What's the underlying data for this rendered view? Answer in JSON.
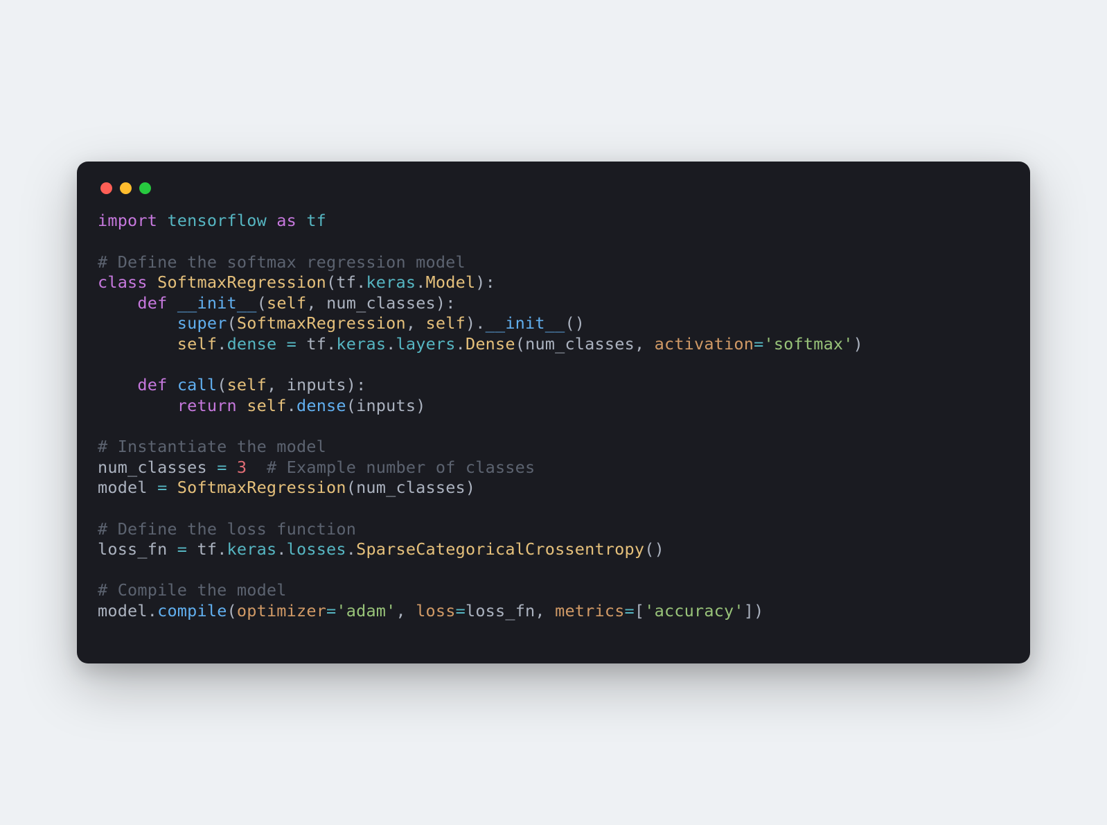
{
  "window": {
    "controls": [
      "close",
      "minimize",
      "zoom"
    ]
  },
  "colors": {
    "background_page": "#eef1f4",
    "background_window": "#1a1b21",
    "text_default": "#abb2bf",
    "keyword": "#c678dd",
    "module": "#56b6c2",
    "class_name": "#e5c07b",
    "function": "#61afef",
    "self": "#e5c07b",
    "operator": "#56b6c2",
    "number": "#e06c75",
    "string": "#98c379",
    "comment": "#5c6370",
    "kwarg": "#d19a66",
    "variable": "#e06c75",
    "dot_red": "#ff5f56",
    "dot_yellow": "#ffbd2e",
    "dot_green": "#27c93f"
  },
  "code": {
    "language": "python",
    "lines": [
      [
        {
          "t": "import ",
          "c": "kw"
        },
        {
          "t": "tensorflow",
          "c": "mod"
        },
        {
          "t": " as ",
          "c": "kw"
        },
        {
          "t": "tf",
          "c": "mod"
        }
      ],
      [],
      [
        {
          "t": "# Define the softmax regression model",
          "c": "comment"
        }
      ],
      [
        {
          "t": "class ",
          "c": "kw"
        },
        {
          "t": "SoftmaxRegression",
          "c": "class"
        },
        {
          "t": "(",
          "c": "punc"
        },
        {
          "t": "tf",
          "c": "ident"
        },
        {
          "t": ".",
          "c": "punc"
        },
        {
          "t": "keras",
          "c": "attr"
        },
        {
          "t": ".",
          "c": "punc"
        },
        {
          "t": "Model",
          "c": "class"
        },
        {
          "t": "):",
          "c": "punc"
        }
      ],
      [
        {
          "t": "    ",
          "c": "punc"
        },
        {
          "t": "def ",
          "c": "kw"
        },
        {
          "t": "__init__",
          "c": "func"
        },
        {
          "t": "(",
          "c": "punc"
        },
        {
          "t": "self",
          "c": "self"
        },
        {
          "t": ", ",
          "c": "punc"
        },
        {
          "t": "num_classes",
          "c": "param"
        },
        {
          "t": "):",
          "c": "punc"
        }
      ],
      [
        {
          "t": "        ",
          "c": "punc"
        },
        {
          "t": "super",
          "c": "func"
        },
        {
          "t": "(",
          "c": "punc"
        },
        {
          "t": "SoftmaxRegression",
          "c": "class"
        },
        {
          "t": ", ",
          "c": "punc"
        },
        {
          "t": "self",
          "c": "self"
        },
        {
          "t": ").",
          "c": "punc"
        },
        {
          "t": "__init__",
          "c": "func"
        },
        {
          "t": "()",
          "c": "punc"
        }
      ],
      [
        {
          "t": "        ",
          "c": "punc"
        },
        {
          "t": "self",
          "c": "self"
        },
        {
          "t": ".",
          "c": "punc"
        },
        {
          "t": "dense",
          "c": "attr"
        },
        {
          "t": " = ",
          "c": "op"
        },
        {
          "t": "tf",
          "c": "ident"
        },
        {
          "t": ".",
          "c": "punc"
        },
        {
          "t": "keras",
          "c": "attr"
        },
        {
          "t": ".",
          "c": "punc"
        },
        {
          "t": "layers",
          "c": "attr"
        },
        {
          "t": ".",
          "c": "punc"
        },
        {
          "t": "Dense",
          "c": "class"
        },
        {
          "t": "(",
          "c": "punc"
        },
        {
          "t": "num_classes",
          "c": "ident"
        },
        {
          "t": ", ",
          "c": "punc"
        },
        {
          "t": "activation",
          "c": "kwarg"
        },
        {
          "t": "=",
          "c": "op"
        },
        {
          "t": "'softmax'",
          "c": "str"
        },
        {
          "t": ")",
          "c": "punc"
        }
      ],
      [],
      [
        {
          "t": "    ",
          "c": "punc"
        },
        {
          "t": "def ",
          "c": "kw"
        },
        {
          "t": "call",
          "c": "func"
        },
        {
          "t": "(",
          "c": "punc"
        },
        {
          "t": "self",
          "c": "self"
        },
        {
          "t": ", ",
          "c": "punc"
        },
        {
          "t": "inputs",
          "c": "param"
        },
        {
          "t": "):",
          "c": "punc"
        }
      ],
      [
        {
          "t": "        ",
          "c": "punc"
        },
        {
          "t": "return ",
          "c": "kw"
        },
        {
          "t": "self",
          "c": "self"
        },
        {
          "t": ".",
          "c": "punc"
        },
        {
          "t": "dense",
          "c": "func"
        },
        {
          "t": "(",
          "c": "punc"
        },
        {
          "t": "inputs",
          "c": "ident"
        },
        {
          "t": ")",
          "c": "punc"
        }
      ],
      [],
      [
        {
          "t": "# Instantiate the model",
          "c": "comment"
        }
      ],
      [
        {
          "t": "num_classes",
          "c": "ident"
        },
        {
          "t": " = ",
          "c": "op"
        },
        {
          "t": "3",
          "c": "num"
        },
        {
          "t": "  ",
          "c": "punc"
        },
        {
          "t": "# Example number of classes",
          "c": "comment"
        }
      ],
      [
        {
          "t": "model",
          "c": "ident"
        },
        {
          "t": " = ",
          "c": "op"
        },
        {
          "t": "SoftmaxRegression",
          "c": "class"
        },
        {
          "t": "(",
          "c": "punc"
        },
        {
          "t": "num_classes",
          "c": "ident"
        },
        {
          "t": ")",
          "c": "punc"
        }
      ],
      [],
      [
        {
          "t": "# Define the loss function",
          "c": "comment"
        }
      ],
      [
        {
          "t": "loss_fn",
          "c": "ident"
        },
        {
          "t": " = ",
          "c": "op"
        },
        {
          "t": "tf",
          "c": "ident"
        },
        {
          "t": ".",
          "c": "punc"
        },
        {
          "t": "keras",
          "c": "attr"
        },
        {
          "t": ".",
          "c": "punc"
        },
        {
          "t": "losses",
          "c": "attr"
        },
        {
          "t": ".",
          "c": "punc"
        },
        {
          "t": "SparseCategoricalCrossentropy",
          "c": "class"
        },
        {
          "t": "()",
          "c": "punc"
        }
      ],
      [],
      [
        {
          "t": "# Compile the model",
          "c": "comment"
        }
      ],
      [
        {
          "t": "model",
          "c": "ident"
        },
        {
          "t": ".",
          "c": "punc"
        },
        {
          "t": "compile",
          "c": "func"
        },
        {
          "t": "(",
          "c": "punc"
        },
        {
          "t": "optimizer",
          "c": "kwarg"
        },
        {
          "t": "=",
          "c": "op"
        },
        {
          "t": "'adam'",
          "c": "str"
        },
        {
          "t": ", ",
          "c": "punc"
        },
        {
          "t": "loss",
          "c": "kwarg"
        },
        {
          "t": "=",
          "c": "op"
        },
        {
          "t": "loss_fn",
          "c": "ident"
        },
        {
          "t": ", ",
          "c": "punc"
        },
        {
          "t": "metrics",
          "c": "kwarg"
        },
        {
          "t": "=",
          "c": "op"
        },
        {
          "t": "[",
          "c": "punc"
        },
        {
          "t": "'accuracy'",
          "c": "str"
        },
        {
          "t": "])",
          "c": "punc"
        }
      ]
    ]
  }
}
